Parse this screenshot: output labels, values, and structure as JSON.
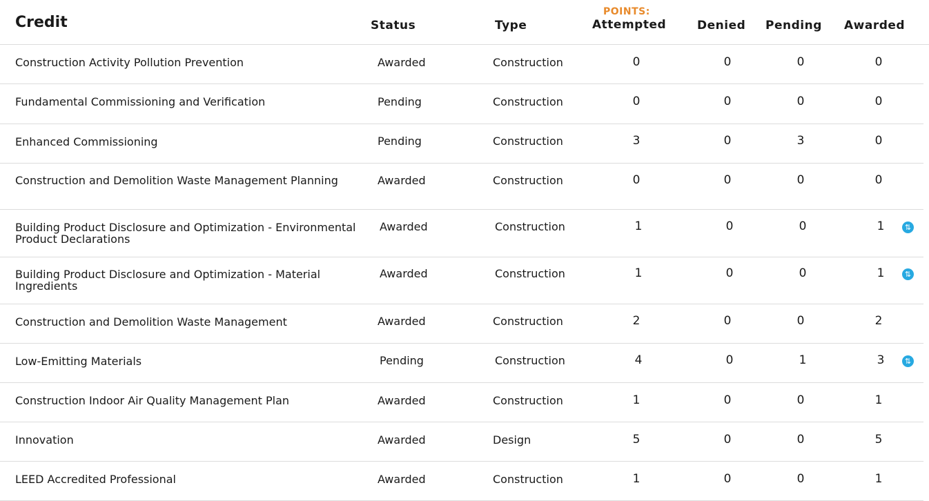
{
  "header": {
    "credit": "Credit",
    "status": "Status",
    "type": "Type",
    "points_label": "POINTS:",
    "attempted": "Attempted",
    "denied": "Denied",
    "pending": "Pending",
    "awarded": "Awarded"
  },
  "accent_color": "#e88a2b",
  "badge_color": "#27a9e1",
  "rows": [
    {
      "credit": "Construction Activity Pollution Prevention",
      "status": "Awarded",
      "type": "Construction",
      "attempted": "0",
      "denied": "0",
      "pending": "0",
      "awarded": "0",
      "badge": false
    },
    {
      "credit": "Fundamental Commissioning and Verification",
      "status": "Pending",
      "type": "Construction",
      "attempted": "0",
      "denied": "0",
      "pending": "0",
      "awarded": "0",
      "badge": false
    },
    {
      "credit": "Enhanced Commissioning",
      "status": "Pending",
      "type": "Construction",
      "attempted": "3",
      "denied": "0",
      "pending": "3",
      "awarded": "0",
      "badge": false
    },
    {
      "credit": "Construction and Demolition Waste Management Planning",
      "status": "Awarded",
      "type": "Construction",
      "attempted": "0",
      "denied": "0",
      "pending": "0",
      "awarded": "0",
      "badge": false
    },
    {
      "credit": "Building Product Disclosure and Optimization - Environmental Product Declarations",
      "status": "Awarded",
      "type": "Construction",
      "attempted": "1",
      "denied": "0",
      "pending": "0",
      "awarded": "1",
      "badge": true
    },
    {
      "credit": "Building Product Disclosure and Optimization - Material Ingredients",
      "status": "Awarded",
      "type": "Construction",
      "attempted": "1",
      "denied": "0",
      "pending": "0",
      "awarded": "1",
      "badge": true
    },
    {
      "credit": "Construction and Demolition Waste Management",
      "status": "Awarded",
      "type": "Construction",
      "attempted": "2",
      "denied": "0",
      "pending": "0",
      "awarded": "2",
      "badge": false
    },
    {
      "credit": "Low-Emitting Materials",
      "status": "Pending",
      "type": "Construction",
      "attempted": "4",
      "denied": "0",
      "pending": "1",
      "awarded": "3",
      "badge": true
    },
    {
      "credit": "Construction Indoor Air Quality Management Plan",
      "status": "Awarded",
      "type": "Construction",
      "attempted": "1",
      "denied": "0",
      "pending": "0",
      "awarded": "1",
      "badge": false
    },
    {
      "credit": "Innovation",
      "status": "Awarded",
      "type": "Design",
      "attempted": "5",
      "denied": "0",
      "pending": "0",
      "awarded": "5",
      "badge": false
    },
    {
      "credit": "LEED Accredited Professional",
      "status": "Awarded",
      "type": "Construction",
      "attempted": "1",
      "denied": "0",
      "pending": "0",
      "awarded": "1",
      "badge": false
    }
  ]
}
